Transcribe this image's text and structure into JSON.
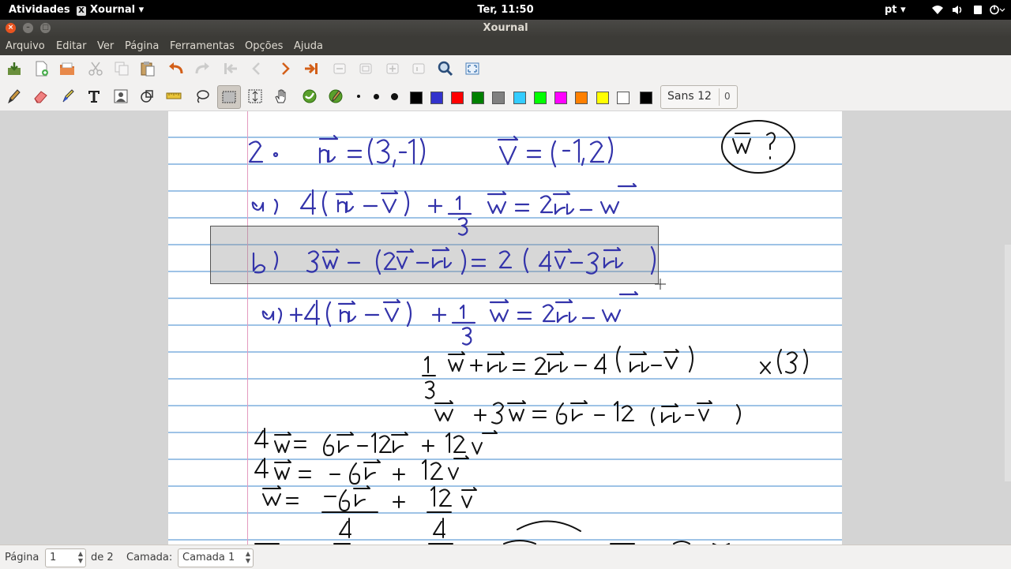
{
  "topbar": {
    "activities": "Atividades",
    "app_menu": "Xournal",
    "app_menu_arrow": "▾",
    "clock": "Ter, 11:50",
    "lang": "pt",
    "lang_arrow": "▾"
  },
  "window": {
    "title": "Xournal"
  },
  "menu": [
    "Arquivo",
    "Editar",
    "Ver",
    "Página",
    "Ferramentas",
    "Opções",
    "Ajuda"
  ],
  "toolbar": {
    "font_name": "Sans 12",
    "font_extra": "0",
    "colors": [
      "#000000",
      "#3333cc",
      "#ff0000",
      "#008000",
      "#808080",
      "#33ccff",
      "#00ff00",
      "#ff00ff",
      "#ff8000",
      "#ffff00",
      "#ffffff",
      "#000000"
    ]
  },
  "status": {
    "page_label": "Página",
    "page_value": "1",
    "page_of": "de 2",
    "layer_label": "Camada:",
    "layer_value": "Camada 1"
  }
}
